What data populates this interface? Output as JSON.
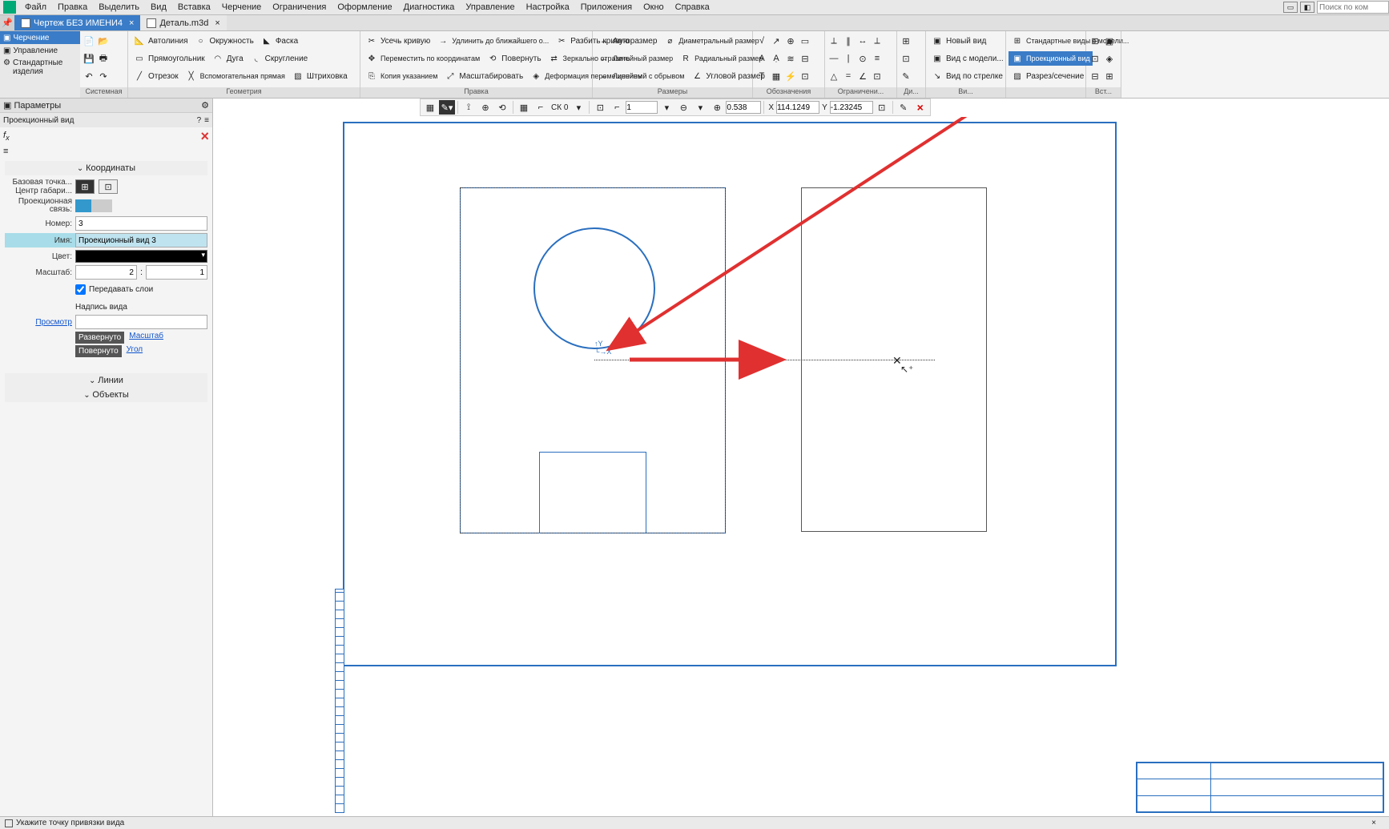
{
  "menubar": {
    "items": [
      "Файл",
      "Правка",
      "Выделить",
      "Вид",
      "Вставка",
      "Черчение",
      "Ограничения",
      "Оформление",
      "Диагностика",
      "Управление",
      "Настройка",
      "Приложения",
      "Окно",
      "Справка"
    ],
    "search_placeholder": "Поиск по ком"
  },
  "tabs": [
    {
      "label": "Чертеж БЕЗ ИМЕНИ4",
      "active": true
    },
    {
      "label": "Деталь.m3d",
      "active": false
    }
  ],
  "leftribbon_tabs": [
    {
      "label": "Черчение",
      "active": true
    },
    {
      "label": "Управление",
      "active": false
    },
    {
      "label": "Стандартные изделия",
      "active": false
    }
  ],
  "ribbon_groups": {
    "systemnaya": "Системная",
    "geometriya": "Геометрия",
    "pravka": "Правка",
    "razmery": "Размеры",
    "oboznacheniya": "Обозначения",
    "ogranicheniya": "Ограничени...",
    "di": "Ди...",
    "vidy": "Ви...",
    "vstavka": "Вст..."
  },
  "ribbon": {
    "avtoliniya": "Автолиния",
    "okruzhnost": "Окружность",
    "faska": "Фаска",
    "pryamougolnik": "Прямоугольник",
    "duga": "Дуга",
    "skruglenie": "Скругление",
    "otrezok": "Отрезок",
    "vspomog": "Вспомогательная прямая",
    "shtrikhovka": "Штриховка",
    "usech": "Усечь кривую",
    "peremestit": "Переместить по координатам",
    "kopiya": "Копия указанием",
    "udlinit": "Удлинить до ближайшего о...",
    "povernut": "Повернуть",
    "masshtab_btn": "Масштабировать",
    "razbit": "Разбить кривую",
    "zerkalno": "Зеркально отразить",
    "deform": "Деформация перемещением",
    "avtorazmer": "Авторазмер",
    "lineyniy": "Линейный размер",
    "lineyniy_obr": "Линейный с обрывом",
    "diametr": "Диаметральный размер",
    "radial": "Радиальный размер",
    "uglovoy": "Угловой размер",
    "noviy_vid": "Новый вид",
    "vid_model": "Вид с модели...",
    "vid_strelke": "Вид по стрелке",
    "std_vidy": "Стандартные виды с модели...",
    "proek_vid": "Проекционный вид",
    "razrez": "Разрез/сечение"
  },
  "toolbar2": {
    "ck": "СК 0",
    "one": "1",
    "scale": "0.538",
    "x_lbl": "X",
    "x_val": "114.1249",
    "y_lbl": "Y",
    "y_val": "-1.23245"
  },
  "params": {
    "title": "Параметры",
    "subtitle": "Проекционный вид",
    "sections": {
      "koord": "Координаты",
      "linii": "Линии",
      "objekty": "Объекты"
    },
    "base_point": "Базовая точка...",
    "center": "Центр габари...",
    "proek_svyaz": "Проекционная связь:",
    "nomer_lbl": "Номер:",
    "nomer_val": "3",
    "imya_lbl": "Имя:",
    "imya_val": "Проекционный вид 3",
    "tsvet_lbl": "Цвет:",
    "masshtab_lbl": "Масштаб:",
    "masshtab_a": "2",
    "masshtab_b": "1",
    "peredavat": "Передавать слои",
    "nadpis": "Надпись вида",
    "prosmotr": "Просмотр",
    "razvernuto": "Развернуто",
    "povernuto": "Повернуто",
    "masshtab_link": "Масштаб",
    "ugol_link": "Угол"
  },
  "status": "Укажите точку привязки вида"
}
